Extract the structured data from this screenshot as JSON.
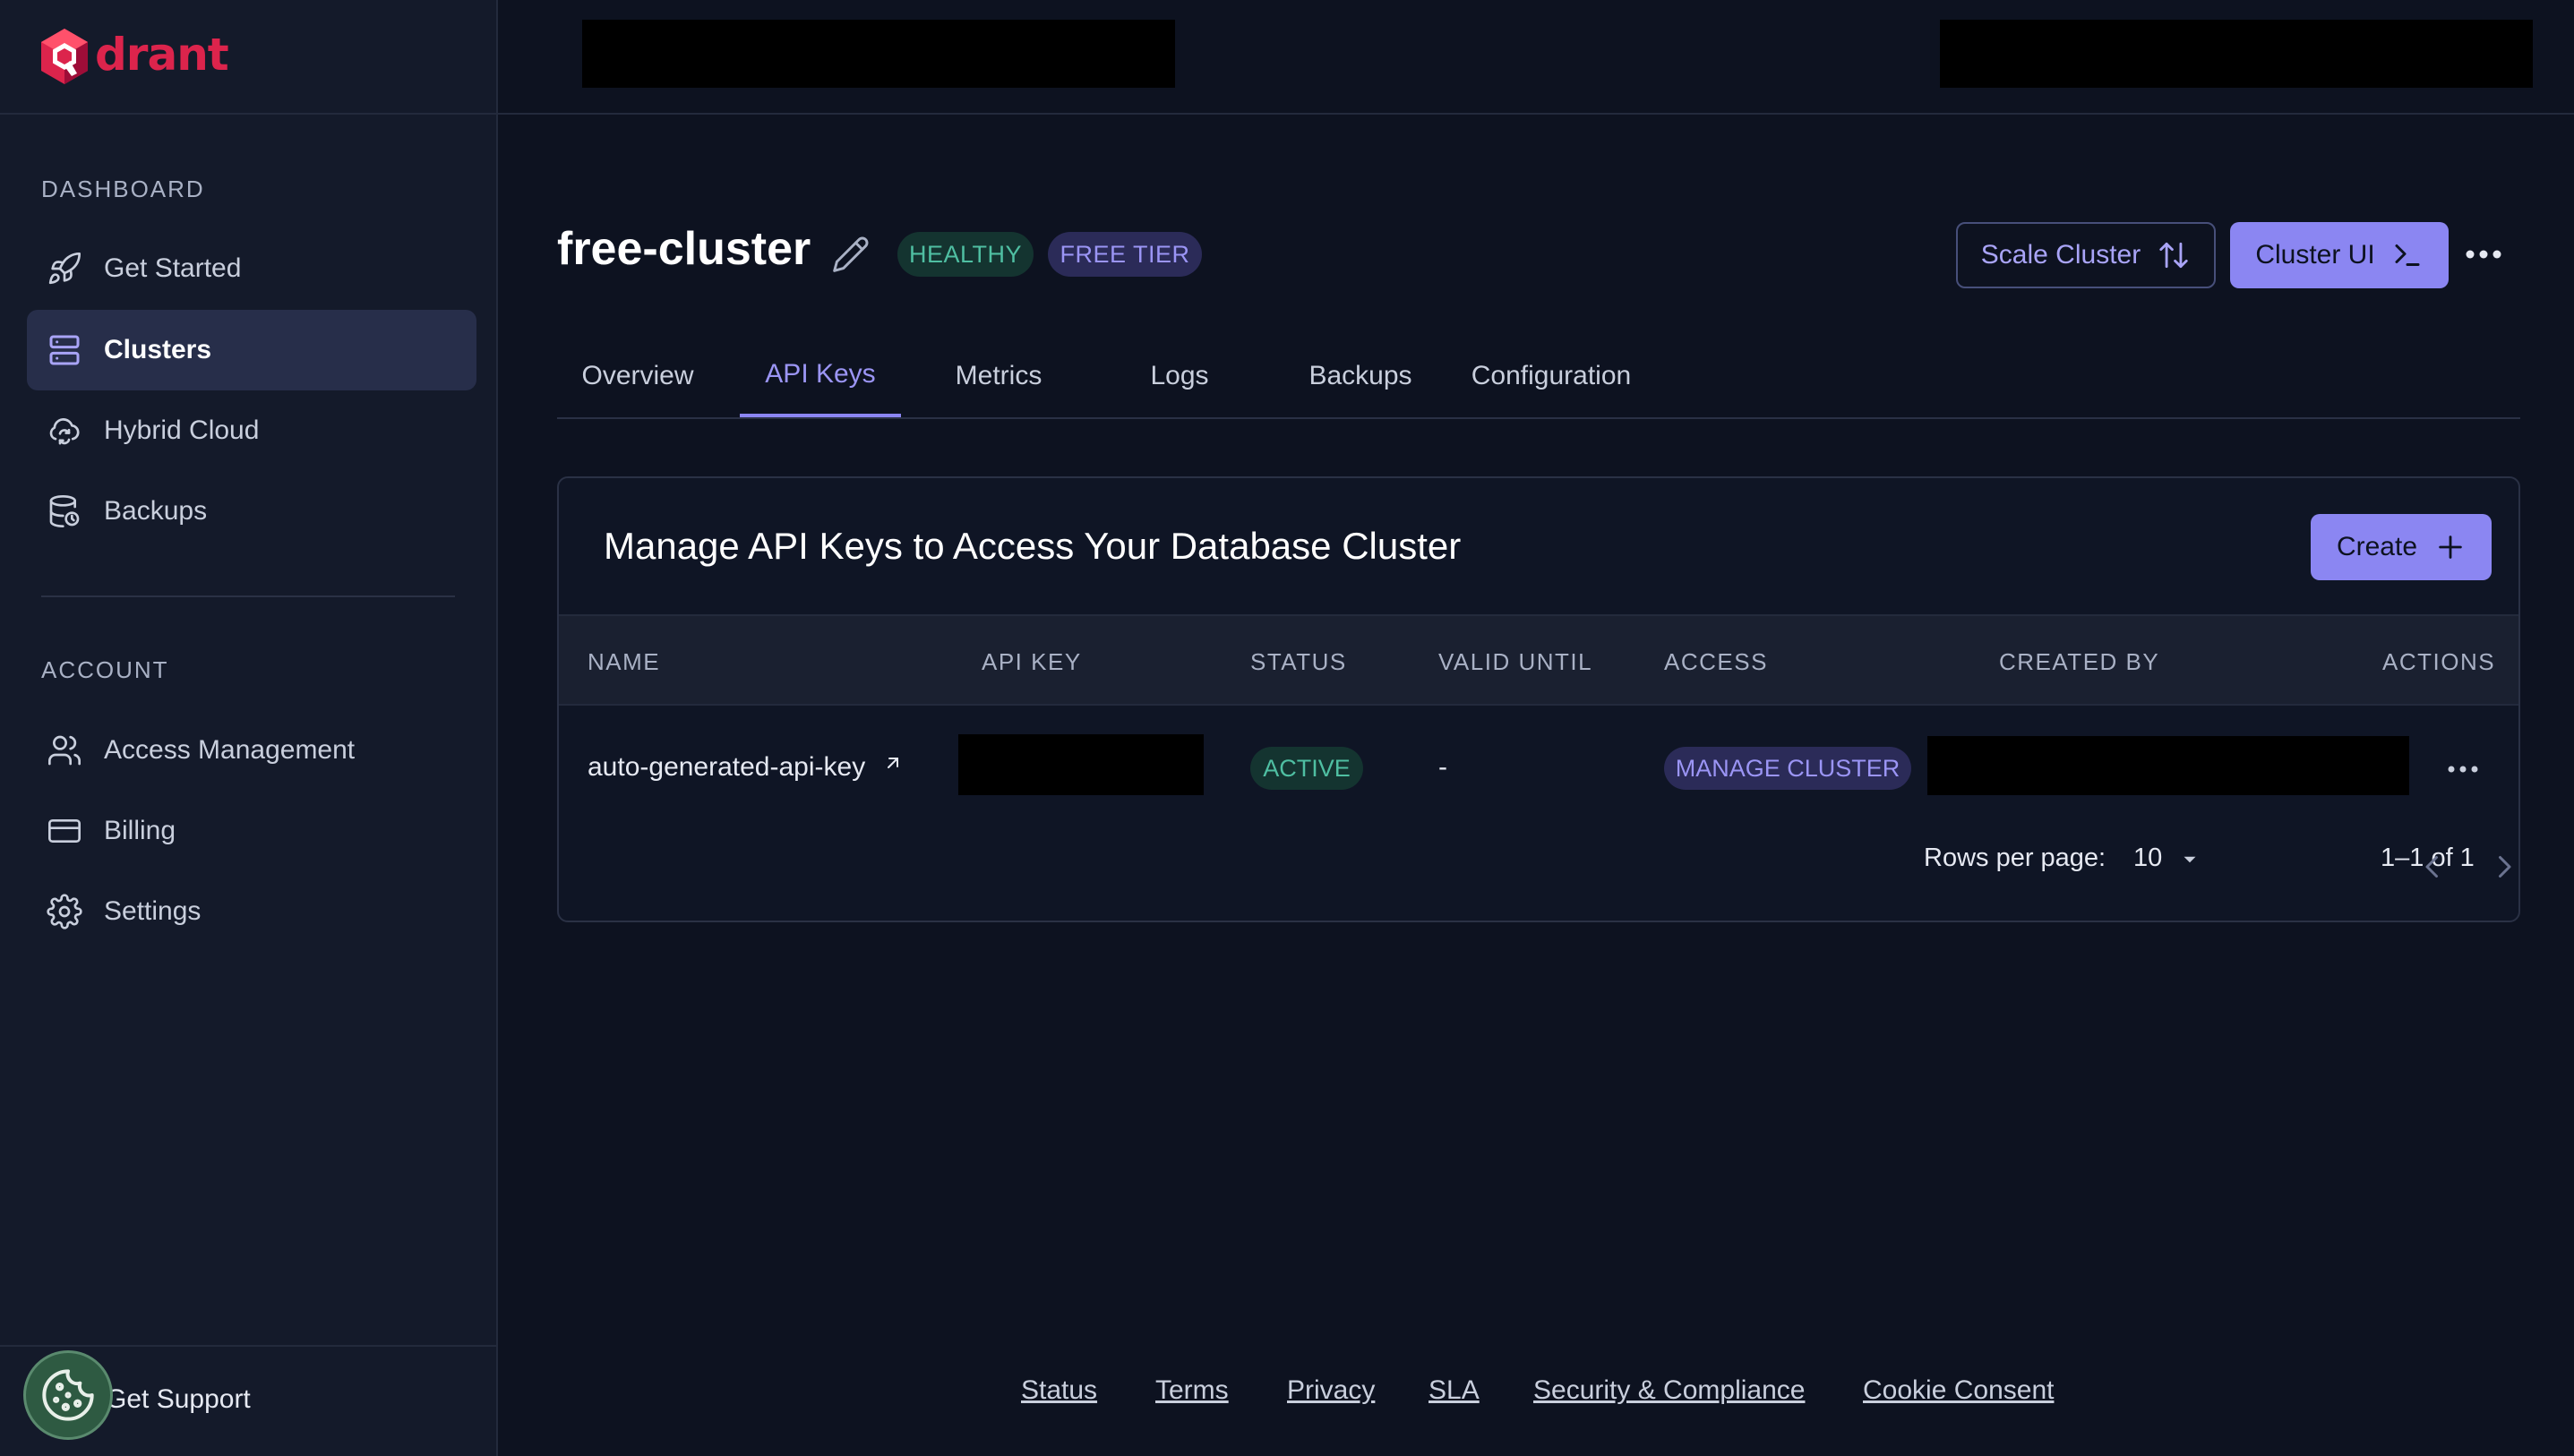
{
  "sidebar": {
    "logo_text": "drant",
    "section_dashboard": "DASHBOARD",
    "section_account": "ACCOUNT",
    "items": [
      {
        "label": "Get Started",
        "icon": "rocket-icon",
        "active": false
      },
      {
        "label": "Clusters",
        "icon": "server-icon",
        "active": true
      },
      {
        "label": "Hybrid Cloud",
        "icon": "cloud-sync-icon",
        "active": false
      },
      {
        "label": "Backups",
        "icon": "database-backup-icon",
        "active": false
      },
      {
        "label": "Access Management",
        "icon": "users-icon",
        "active": false
      },
      {
        "label": "Billing",
        "icon": "credit-card-icon",
        "active": false
      },
      {
        "label": "Settings",
        "icon": "gear-icon",
        "active": false
      }
    ],
    "support_label": "Get Support"
  },
  "header": {
    "cluster_name": "free-cluster",
    "badges": {
      "health": "HEALTHY",
      "tier": "FREE TIER"
    },
    "scale_button": "Scale Cluster",
    "cluster_ui_button": "Cluster UI"
  },
  "tabs": [
    {
      "label": "Overview",
      "active": false
    },
    {
      "label": "API Keys",
      "active": true
    },
    {
      "label": "Metrics",
      "active": false
    },
    {
      "label": "Logs",
      "active": false
    },
    {
      "label": "Backups",
      "active": false
    },
    {
      "label": "Configuration",
      "active": false
    }
  ],
  "api_keys": {
    "title": "Manage API Keys to Access Your Database Cluster",
    "create_button": "Create",
    "columns": [
      "NAME",
      "API KEY",
      "STATUS",
      "VALID UNTIL",
      "ACCESS",
      "CREATED BY",
      "ACTIONS"
    ],
    "rows": [
      {
        "name": "auto-generated-api-key",
        "api_key": "",
        "status": "ACTIVE",
        "valid_until": "-",
        "access": "MANAGE CLUSTER",
        "created_by": ""
      }
    ],
    "pagination": {
      "rows_per_page_label": "Rows per page:",
      "rows_per_page": "10",
      "range": "1–1 of 1"
    }
  },
  "footer": {
    "links": [
      "Status",
      "Terms",
      "Privacy",
      "SLA",
      "Security & Compliance",
      "Cookie Consent"
    ]
  },
  "colors": {
    "accent": "#8b86f2",
    "healthy": "#4fbfa2",
    "brand": "#dc244c"
  }
}
